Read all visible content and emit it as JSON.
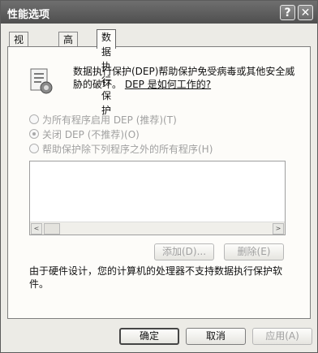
{
  "window": {
    "title": "性能选项",
    "help_label": "?",
    "close_label": "✕"
  },
  "tabs": [
    {
      "label": "视觉效果"
    },
    {
      "label": "高级"
    },
    {
      "label": "数据执行保护"
    }
  ],
  "dep": {
    "description": "数据执行保护(DEP)帮助保护免受病毒或其他安全威胁的破坏。",
    "link": "DEP 是如何工作的?",
    "icon": "dep-settings-icon"
  },
  "options": [
    {
      "label": "为所有程序启用 DEP (推荐)(T)",
      "checked": false
    },
    {
      "label": "关闭 DEP (不推荐)(O)",
      "checked": true
    },
    {
      "label": "帮助保护除下列程序之外的所有程序(H)",
      "checked": false
    }
  ],
  "list": {
    "items": [],
    "scroll_left_label": "<",
    "scroll_right_label": ">"
  },
  "buttons": {
    "add": "添加(D)...",
    "remove": "删除(E)",
    "ok": "确定",
    "cancel": "取消",
    "apply": "应用(A)"
  },
  "note": "由于硬件设计，您的计算机的处理器不支持数据执行保护软件。"
}
